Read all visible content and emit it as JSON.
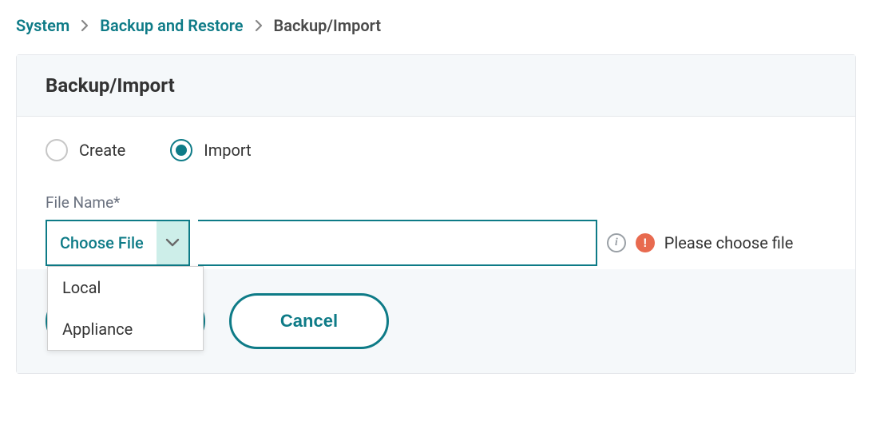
{
  "breadcrumb": {
    "items": [
      {
        "label": "System"
      },
      {
        "label": "Backup and Restore"
      },
      {
        "label": "Backup/Import"
      }
    ]
  },
  "panel": {
    "title": "Backup/Import"
  },
  "radios": {
    "create": "Create",
    "import": "Import"
  },
  "file": {
    "label": "File Name*",
    "choose": "Choose File",
    "options": [
      "Local",
      "Appliance"
    ],
    "error": "Please choose file"
  },
  "buttons": {
    "cancel": "Cancel"
  }
}
